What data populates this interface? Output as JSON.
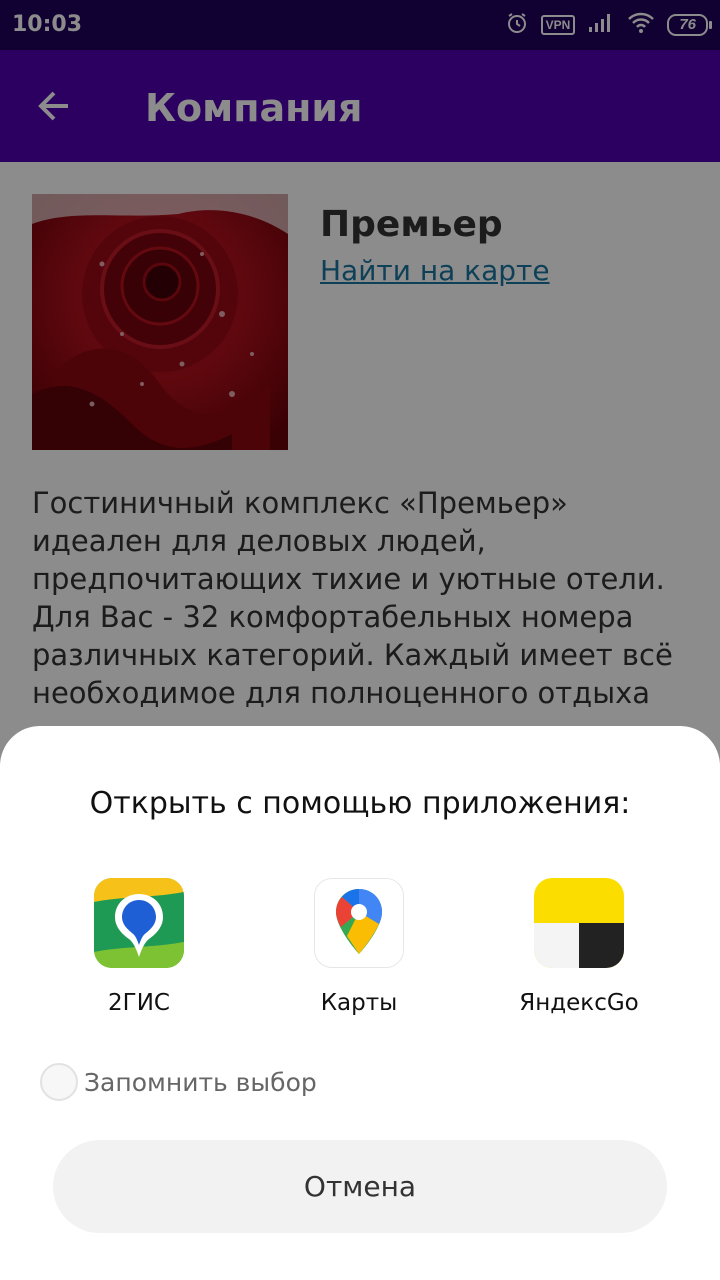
{
  "status_bar": {
    "time": "10:03",
    "vpn_label": "VPN",
    "battery": "76"
  },
  "app_bar": {
    "title": "Компания"
  },
  "company": {
    "name": "Премьер",
    "map_link": "Найти на карте",
    "description": "Гостиничный комплекс «Премьер» идеален для деловых людей, предпочитающих тихие и уютные отели. Для Вас - 32 комфортабельных номера различных категорий. Каждый имеет всё необходимое для полноценного отдыха"
  },
  "sheet": {
    "title": "Открыть с помощью приложения:",
    "apps": [
      {
        "label": "2ГИС",
        "icon": "2gis-icon"
      },
      {
        "label": "Карты",
        "icon": "google-maps-icon"
      },
      {
        "label": "ЯндексGo",
        "icon": "yandex-go-icon"
      }
    ],
    "remember_label": "Запомнить выбор",
    "remember_checked": false,
    "cancel_label": "Отмена"
  },
  "colors": {
    "status_bar": "#20005c",
    "app_bar": "#4f00b0",
    "link": "#1a76a0"
  }
}
